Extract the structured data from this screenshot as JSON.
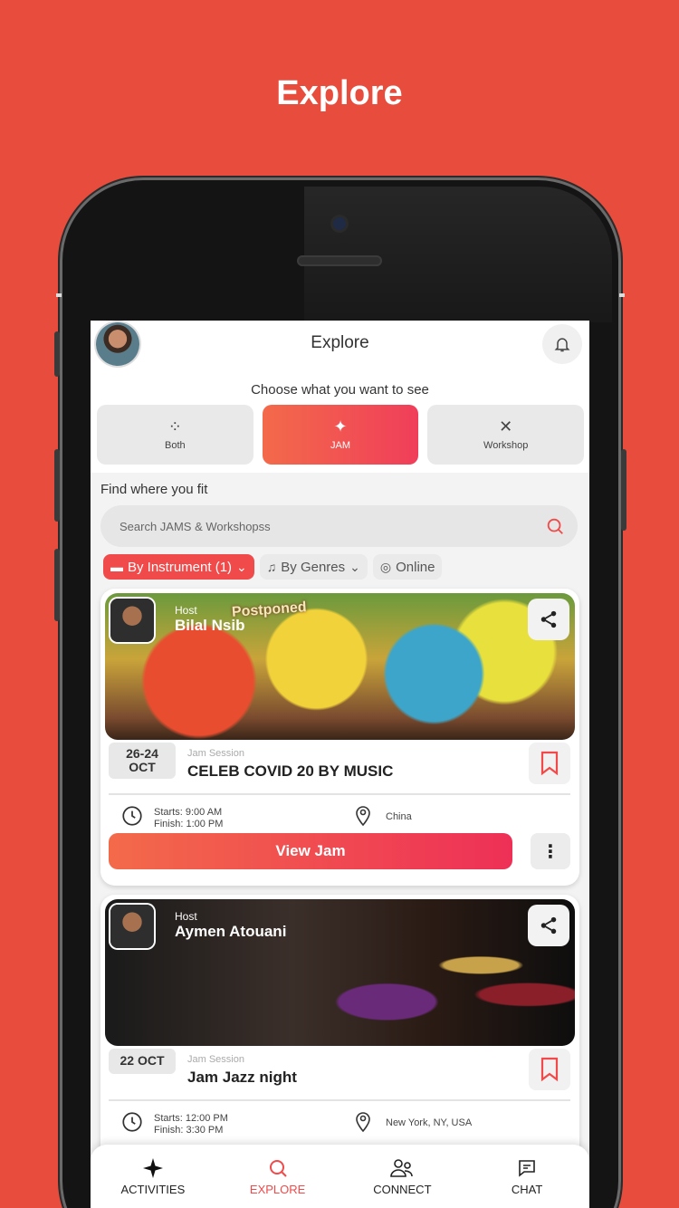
{
  "promo": {
    "title": "Explore"
  },
  "header": {
    "title": "Explore"
  },
  "choose": {
    "label": "Choose what you want to see",
    "options": [
      {
        "label": "Both",
        "icon": "sparkle-small-icon",
        "active": false
      },
      {
        "label": "JAM",
        "icon": "sparkle-icon",
        "active": true
      },
      {
        "label": "Workshop",
        "icon": "x-icon",
        "active": false
      }
    ]
  },
  "find": {
    "label": "Find where you fit",
    "search_placeholder": "Search JAMS & Workshopss"
  },
  "filters": [
    {
      "label": "By Instrument (1)",
      "active": true
    },
    {
      "label": "By Genres",
      "active": false
    },
    {
      "label": "Online",
      "active": false
    }
  ],
  "cards": [
    {
      "host_label": "Host",
      "host_name": "Bilal Nsib",
      "banner": "Postponed",
      "date": [
        "26-24",
        "OCT"
      ],
      "type": "Jam Session",
      "title": "CELEB COVID 20 BY MUSIC",
      "starts": "Starts: 9:00 AM",
      "finish": "Finish: 1:00 PM",
      "location": "China",
      "button": "View Jam"
    },
    {
      "host_label": "Host",
      "host_name": "Aymen Atouani",
      "date": [
        "22 OCT"
      ],
      "type": "Jam Session",
      "title": "Jam Jazz night",
      "starts": "Starts: 12:00 PM",
      "finish": "Finish: 3:30 PM",
      "location": "New York, NY, USA"
    }
  ],
  "nav": [
    {
      "label": "ACTIVITIES",
      "active": false
    },
    {
      "label": "EXPLORE",
      "active": true
    },
    {
      "label": "CONNECT",
      "active": false
    },
    {
      "label": "CHAT",
      "active": false
    }
  ],
  "colors": {
    "background": "#e84c3d",
    "accent": "#f04a4a"
  }
}
